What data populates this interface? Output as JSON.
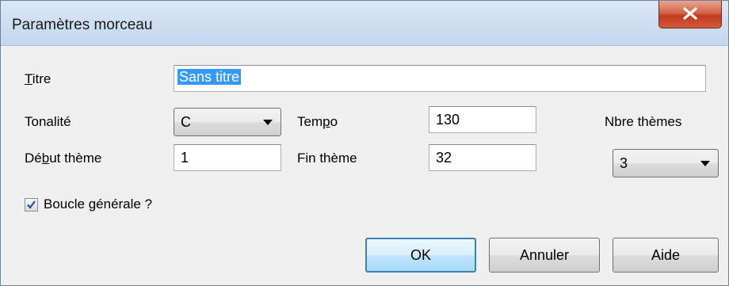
{
  "dialog": {
    "title": "Paramètres morceau",
    "close_symbol": "X"
  },
  "fields": {
    "titre_label_first": "T",
    "titre_label_rest": "itre",
    "titre_value": "Sans titre",
    "tonalite_label": "Tonalité",
    "tonalite_value": "C",
    "tempo_label_a": "Tem",
    "tempo_label_u": "p",
    "tempo_label_b": "o",
    "tempo_value": "130",
    "nbre_themes_label": "Nbre thèmes",
    "nbre_themes_value": "3",
    "debut_label_a": "Dé",
    "debut_label_u": "b",
    "debut_label_b": "ut thème",
    "debut_value": "1",
    "fin_label": "Fin thème",
    "fin_value": "32",
    "boucle_label": "Boucle générale ?",
    "boucle_checked": true
  },
  "buttons": {
    "ok": "OK",
    "annuler": "Annuler",
    "aide": "Aide"
  },
  "colors": {
    "selection": "#3399ff",
    "close_button": "#c23c1f",
    "default_button_border": "#3c7fb1"
  }
}
